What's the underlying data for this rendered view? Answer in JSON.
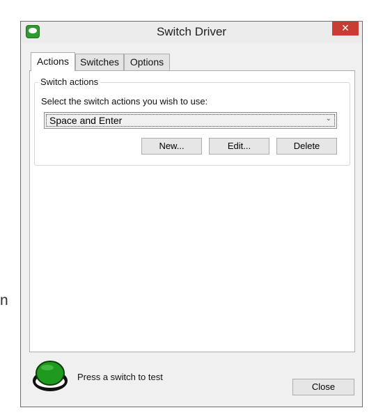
{
  "side_text": "n",
  "window": {
    "title": "Switch Driver",
    "close_glyph": "✕"
  },
  "tabs": [
    {
      "label": "Actions",
      "active": true
    },
    {
      "label": "Switches",
      "active": false
    },
    {
      "label": "Options",
      "active": false
    }
  ],
  "switch_actions": {
    "group_label": "Switch actions",
    "prompt": "Select the switch actions you wish to use:",
    "selected_value": "Space and Enter",
    "buttons": {
      "new_label": "New...",
      "edit_label": "Edit...",
      "delete_label": "Delete"
    }
  },
  "footer": {
    "status_text": "Press a switch to test",
    "close_label": "Close"
  },
  "colors": {
    "switch_green": "#1f9a1f",
    "close_red": "#c83c33"
  },
  "icons": {
    "app": "green-switch-icon",
    "dropdown": "chevron-down-icon",
    "status": "green-switch-button-icon"
  }
}
